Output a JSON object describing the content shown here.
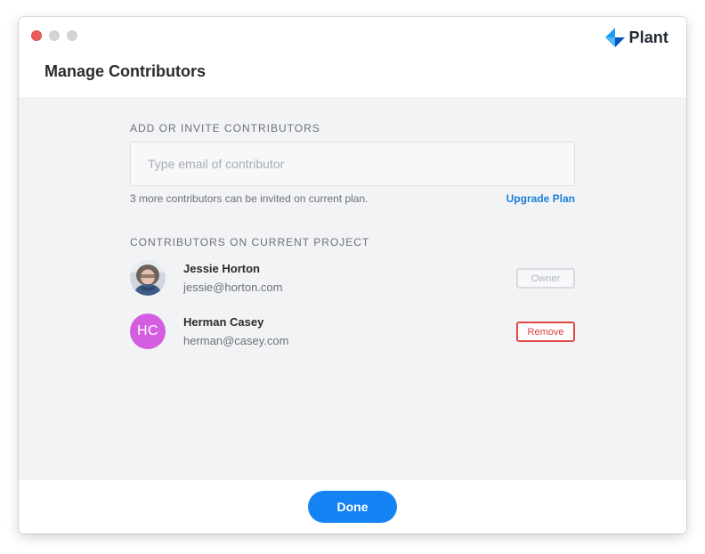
{
  "window": {
    "title": "Manage Contributors",
    "brand": "Plant",
    "brand_colors": [
      "#1b9cf2",
      "#0a4fbf"
    ]
  },
  "invite": {
    "section_label": "ADD OR INVITE CONTRIBUTORS",
    "email_placeholder": "Type email of contributor",
    "email_value": "",
    "hint": "3 more contributors can be invited on current plan.",
    "upgrade_label": "Upgrade Plan"
  },
  "contributors": {
    "section_label": "CONTRIBUTORS ON CURRENT PROJECT",
    "items": [
      {
        "name": "Jessie Horton",
        "email": "jessie@horton.com",
        "avatar": "photo",
        "action": "Owner"
      },
      {
        "name": "Herman Casey",
        "email": "herman@casey.com",
        "avatar_initials": "HC",
        "avatar_color": "#d35fe0",
        "action": "Remove"
      }
    ]
  },
  "footer": {
    "done_label": "Done"
  },
  "colors": {
    "accent": "#1483f5",
    "link": "#1a7fd9",
    "danger": "#e04848"
  }
}
